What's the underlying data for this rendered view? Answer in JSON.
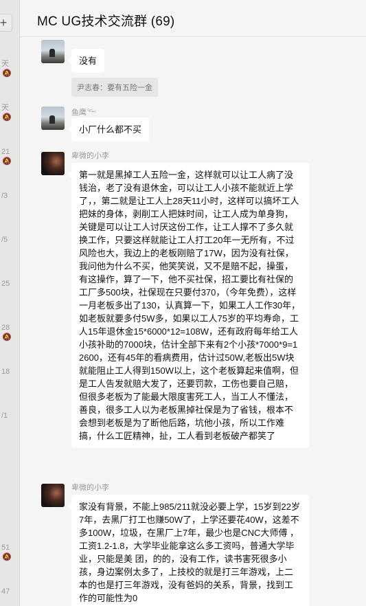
{
  "app": {
    "chat_title": "MC UG技术交流群 (69)"
  },
  "sidebar": {
    "add_label": "+",
    "items": [
      {
        "frag": "天"
      },
      {
        "frag": "天"
      },
      {
        "frag": "21"
      },
      {
        "frag": "/3"
      },
      {
        "frag": "/5"
      },
      {
        "frag": "25"
      },
      {
        "frag": "28"
      },
      {
        "frag": "18"
      },
      {
        "frag": "/1"
      },
      {
        "frag": "51"
      },
      {
        "frag": "47"
      }
    ]
  },
  "messages": [
    {
      "type": "text",
      "sender": "",
      "avatar": "landscape-avatar",
      "text": "没有"
    },
    {
      "type": "quote",
      "text": "尹志春：要有五险一金"
    },
    {
      "type": "text",
      "sender": "鱼鹰𓆝",
      "avatar": "landscape-avatar",
      "text": "小厂什么都不买"
    },
    {
      "type": "text",
      "sender": "卑微的小李",
      "avatar": "portrait-avatar",
      "text": "第一就是黑掉工人五险一金，这样就可以让工人病了没钱治，老了没有退休金，可以让工人小孩不能就近上学了，，第二就是让工人上28天11小时，这样可以搞坏工人把妹的身体，剥削工人把妹时间，让工人成为单身狗，关键是可以让工人讨厌这份工作，让工人撑不了多久就换工作，只要这样就能让工人打工20年一无所有，不过风险也大，我边上的老板刚赔了17W，因为没有社保，我问他为什么不买，他笑笑说，又不是赔不起，操蛋，有这操作，算了一下，他不买社保，招工要比有社保的工厂多500块，社保现在只要付370，（今年免费），这样一月老板多出了130，认真算一下，如果工人工作30年，如老板就要多付5W多，如果以工人75岁的平均寿命，工人15年退休金15*6000*12=108W，还有政府每年给工人小孩补助的7000块，估计全部下来有2个小孩*7000*9=12600，还有45年的看病费用，估计过50W,老板出5W块就能阻止工人得到150W以上，这个老板算起来值啊，但是工人告发就赔大发了，还要罚款，工伤也要自己赔，但很多老板为了能最大限度害死工人，当工人不懂法，善良，很多工人以为老板黑掉社保是为了省钱，根本不会想到老板是为了断他后路，坑他小孩，所以工作难搞，什么工匠精神，扯，工人看到老板破产都笑了"
    },
    {
      "type": "text",
      "sender": "卑微的小李",
      "avatar": "portrait-avatar",
      "text": "家没有背景，不能上985/211就没必要上学，15岁到22岁7年，去黑厂打工也赚50W了，上学还要花40W，这差不多100W，垃圾，在黑厂上7年，最少也是CNC大师傅 ，工资1.2-1.8，大学毕业能拿这么多工资吗，普通大学毕业，只能是美 团，的的，没有工作，读书害死很多小孩，身边案例太多了，上技校的就是打三年游戏，上二本的也是打三年游戏，没有爸妈的关系，背景，找到工作的可能性为0"
    }
  ]
}
